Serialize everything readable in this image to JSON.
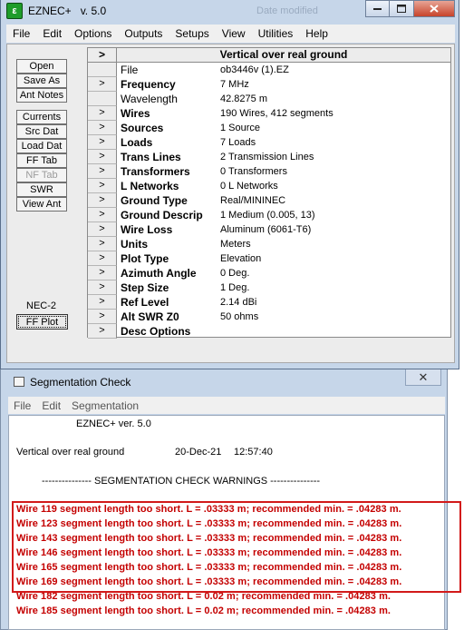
{
  "main_window": {
    "app_name": "EZNEC+",
    "version": "v. 5.0",
    "ghost_text": "Date modified",
    "menu": [
      "File",
      "Edit",
      "Options",
      "Outputs",
      "Setups",
      "View",
      "Utilities",
      "Help"
    ],
    "left_buttons_top": [
      "Open",
      "Save As",
      "Ant Notes"
    ],
    "left_buttons_bottom": [
      {
        "label": "Currents",
        "enabled": true
      },
      {
        "label": "Src Dat",
        "enabled": true
      },
      {
        "label": "Load Dat",
        "enabled": true
      },
      {
        "label": "FF Tab",
        "enabled": true
      },
      {
        "label": "NF Tab",
        "enabled": false
      },
      {
        "label": "SWR",
        "enabled": true
      },
      {
        "label": "View Ant",
        "enabled": true
      }
    ],
    "engine_label": "NEC-2",
    "plot_button": "FF Plot",
    "grid": {
      "header_arrow": ">",
      "title": "Vertical over real ground",
      "rows": [
        {
          "arrow": "",
          "label": "File",
          "value": "ob3446v (1).EZ",
          "bold": false
        },
        {
          "arrow": ">",
          "label": "Frequency",
          "value": "7 MHz",
          "bold": true
        },
        {
          "arrow": "",
          "label": "Wavelength",
          "value": "42.8275 m",
          "bold": false
        },
        {
          "arrow": ">",
          "label": "Wires",
          "value": "190 Wires, 412 segments",
          "bold": true
        },
        {
          "arrow": ">",
          "label": "Sources",
          "value": "1 Source",
          "bold": true
        },
        {
          "arrow": ">",
          "label": "Loads",
          "value": "7 Loads",
          "bold": true
        },
        {
          "arrow": ">",
          "label": "Trans Lines",
          "value": "2 Transmission Lines",
          "bold": true
        },
        {
          "arrow": ">",
          "label": "Transformers",
          "value": "0 Transformers",
          "bold": true
        },
        {
          "arrow": ">",
          "label": "L Networks",
          "value": "0 L Networks",
          "bold": true
        },
        {
          "arrow": ">",
          "label": "Ground Type",
          "value": "Real/MININEC",
          "bold": true
        },
        {
          "arrow": ">",
          "label": "Ground Descrip",
          "value": "1 Medium (0.005, 13)",
          "bold": true
        },
        {
          "arrow": ">",
          "label": "Wire Loss",
          "value": "Aluminum (6061-T6)",
          "bold": true
        },
        {
          "arrow": ">",
          "label": "Units",
          "value": "Meters",
          "bold": true
        },
        {
          "arrow": ">",
          "label": "Plot Type",
          "value": "Elevation",
          "bold": true
        },
        {
          "arrow": ">",
          "label": "Azimuth Angle",
          "value": "0 Deg.",
          "bold": true
        },
        {
          "arrow": ">",
          "label": "Step Size",
          "value": "1 Deg.",
          "bold": true
        },
        {
          "arrow": ">",
          "label": "Ref Level",
          "value": "2.14 dBi",
          "bold": true
        },
        {
          "arrow": ">",
          "label": "Alt SWR Z0",
          "value": "50 ohms",
          "bold": true
        },
        {
          "arrow": ">",
          "label": "Desc Options",
          "value": "",
          "bold": true
        }
      ]
    }
  },
  "seg_window": {
    "title": "Segmentation Check",
    "close_glyph": "✕",
    "menu": [
      "File",
      "Edit",
      "Segmentation"
    ],
    "header_line": "EZNEC+ ver. 5.0",
    "model_name": "Vertical over real ground",
    "date": "20-Dec-21",
    "time": "12:57:40",
    "section_title": "--------------- SEGMENTATION CHECK WARNINGS ---------------",
    "warnings": [
      "Wire 119 segment length too short. L = .03333 m; recommended min. = .04283 m.",
      "Wire 123 segment length too short. L = .03333 m; recommended min. = .04283 m.",
      "Wire 143 segment length too short. L = .03333 m; recommended min. = .04283 m.",
      "Wire 146 segment length too short. L = .03333 m; recommended min. = .04283 m.",
      "Wire 165 segment length too short. L = .03333 m; recommended min. = .04283 m.",
      "Wire 169 segment length too short. L = .03333 m; recommended min. = .04283 m.",
      "Wire 182 segment length too short. L = 0.02 m; recommended min. = .04283 m.",
      "Wire 185 segment length too short. L = 0.02 m; recommended min. = .04283 m."
    ],
    "highlighted_warning_count": 6
  },
  "colors": {
    "window_frame": "#c6d6e9",
    "warning_text": "#c40000",
    "highlight_box": "#d21a1a",
    "close_button": "#c7432b"
  }
}
